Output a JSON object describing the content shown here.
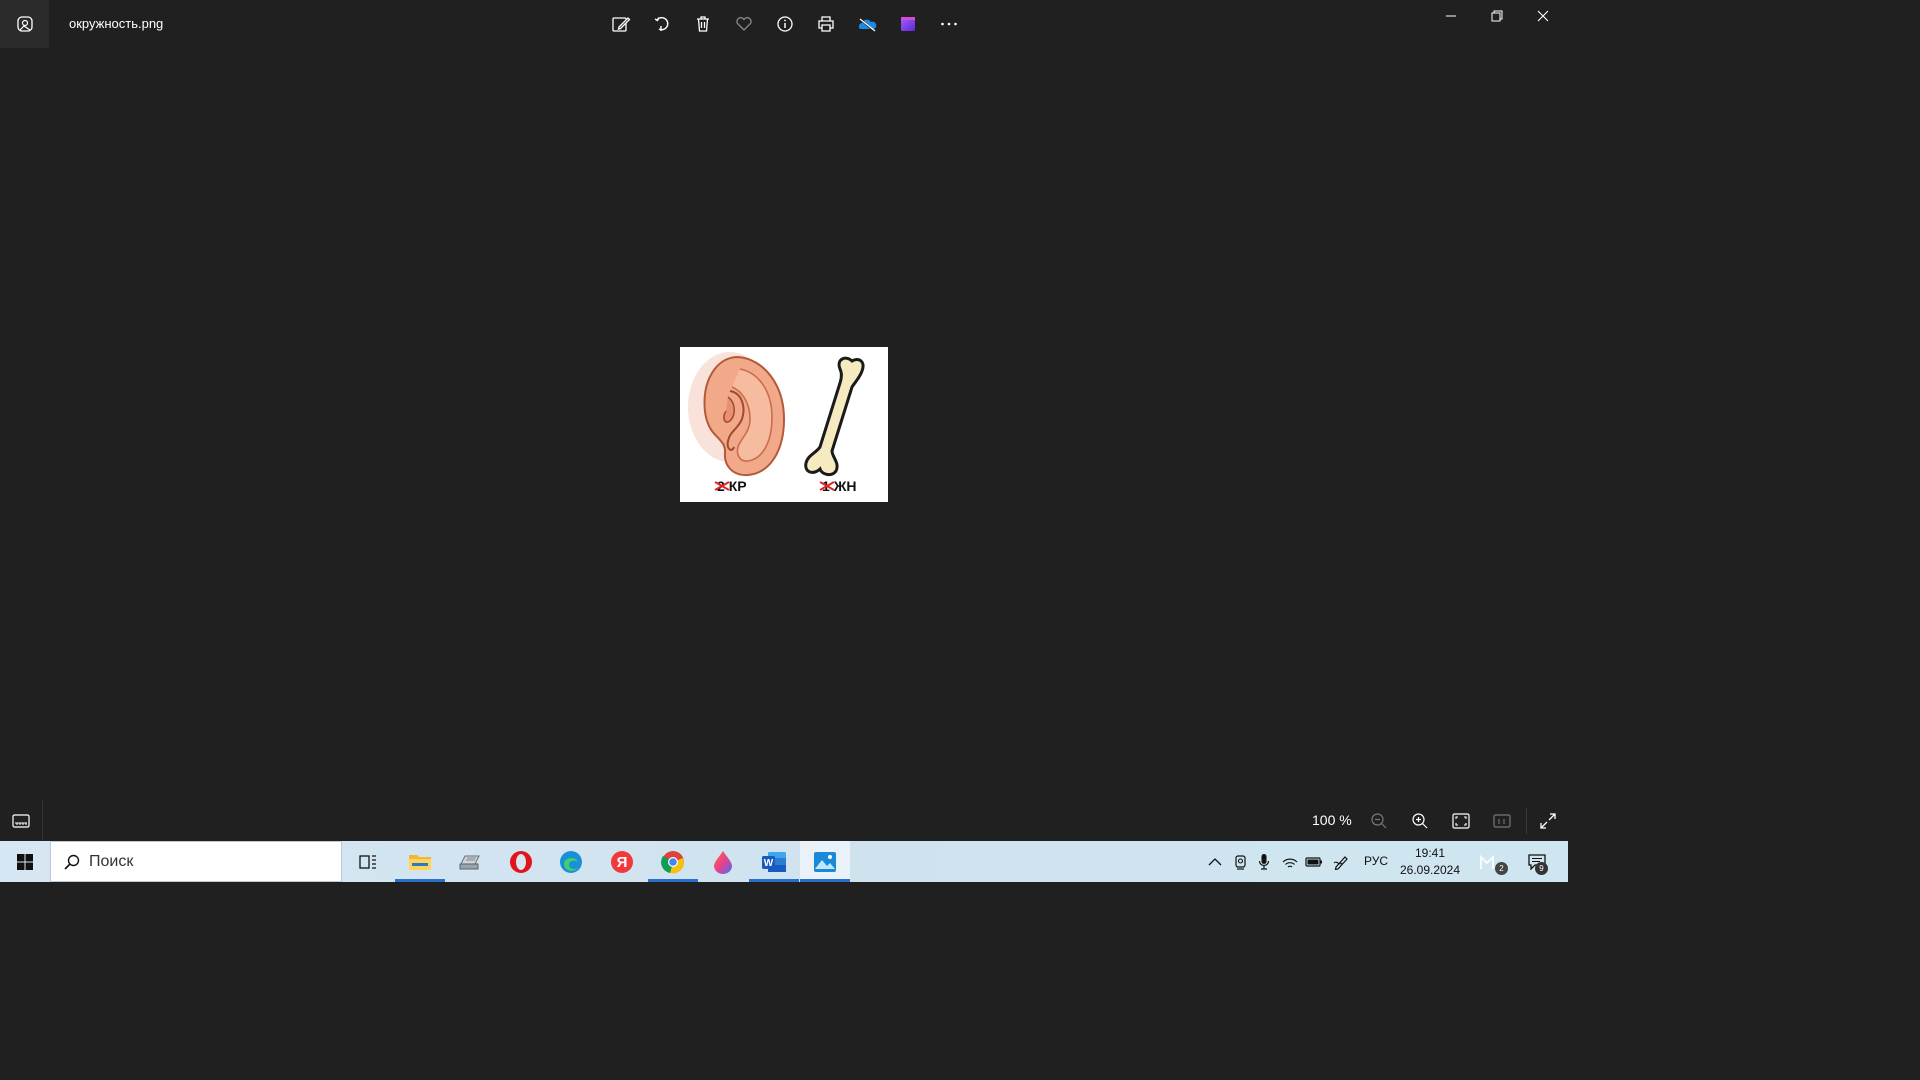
{
  "window": {
    "file_name": "окружность.png"
  },
  "toolbar": {
    "icons": [
      "edit-image-icon",
      "rotate-icon",
      "delete-icon",
      "favorite-icon",
      "info-icon",
      "print-icon",
      "onedrive-icon",
      "video-editor-icon",
      "more-icon"
    ]
  },
  "image": {
    "left_caption_number": "2",
    "left_caption_text": "КР",
    "right_caption_number": "1",
    "right_caption_text": "ЖН"
  },
  "bottombar": {
    "zoom_level": "100 %"
  },
  "taskbar": {
    "search_placeholder": "Поиск",
    "language": "РУС",
    "time": "19:41",
    "date": "26.09.2024",
    "notification_count": "9",
    "meet_badge": "2"
  },
  "colors": {
    "background": "#202020",
    "taskbar": "#d6e6f3",
    "accent": "#2a6fc9"
  }
}
